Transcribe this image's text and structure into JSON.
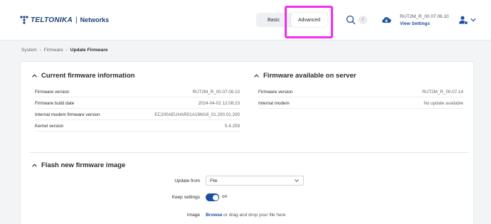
{
  "header": {
    "brand": "TELTONIKA",
    "brand_sub": "Networks",
    "modes": [
      "Basic",
      "Advanced"
    ],
    "active_mode": "Advanced",
    "search_shortcut": "/",
    "firmware_version": "RUT2M_R_00.07.06.10",
    "view_settings": "View Settings"
  },
  "breadcrumb": [
    "System",
    "Firmware",
    "Update Firmware"
  ],
  "current_fw": {
    "title": "Current firmware information",
    "rows": [
      {
        "label": "Firmware version",
        "value": "RUT2M_R_00.07.06.10"
      },
      {
        "label": "Firmware build date",
        "value": "2024-04-02 12:08:23"
      },
      {
        "label": "Internal modem firmware version",
        "value": "EC200AEUHAR01A19M16_01.200.01.200"
      },
      {
        "label": "Kernel version",
        "value": "5.4.259"
      }
    ]
  },
  "server_fw": {
    "title": "Firmware available on server",
    "rows": [
      {
        "label": "Firmware version",
        "value": "RUT2M_R_00.07.14"
      },
      {
        "label": "Internal modem",
        "value": "No update available"
      }
    ]
  },
  "flash": {
    "title": "Flash new firmware image",
    "update_from_label": "Update from",
    "update_from_value": "File",
    "keep_settings_label": "Keep settings",
    "keep_settings_state": "on",
    "image_label": "Image",
    "browse": "Browse",
    "drop_text": "or drag and drop your file here"
  },
  "colors": {
    "brand": "#1c3f79",
    "accent": "#1c4fa3",
    "annotation": "#f22cf0"
  }
}
